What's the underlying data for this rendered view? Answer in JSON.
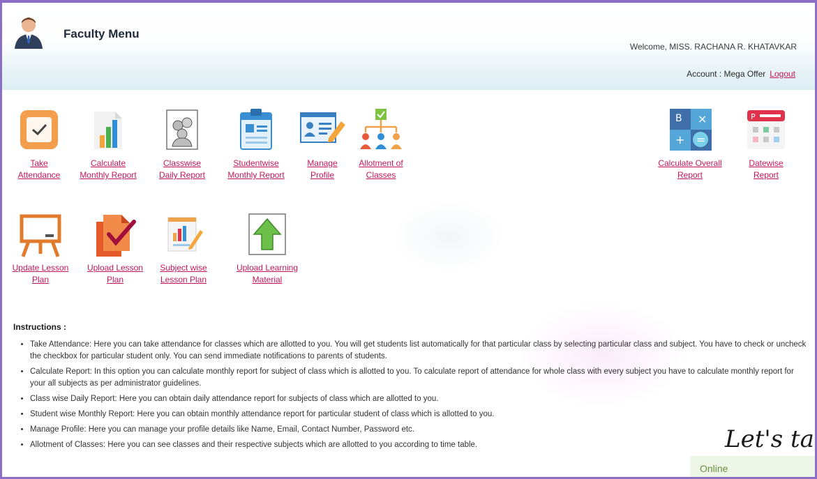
{
  "header": {
    "title": "Faculty Menu",
    "welcome": "Welcome, MISS. RACHANA R. KHATAVKAR",
    "account_label": "Account : Mega Offer",
    "logout_label": "Logout"
  },
  "menu": {
    "take_attendance": {
      "line1": "Take",
      "line2": "Attendance"
    },
    "calculate_monthly": {
      "line1": "Calculate",
      "line2": "Monthly Report"
    },
    "classwise_daily": {
      "line1": "Classwise",
      "line2": "Daily Report"
    },
    "studentwise_monthly": {
      "line1": "Studentwise",
      "line2": "Monthly Report"
    },
    "manage_profile": {
      "line1": "Manage",
      "line2": "Profile"
    },
    "allotment": {
      "line1": "Allotment of",
      "line2": "Classes"
    },
    "calculate_overall": {
      "line1": "Calculate Overall",
      "line2": "Report"
    },
    "datewise": {
      "line1": "Datewise",
      "line2": "Report"
    },
    "update_lesson": {
      "line1": "Update Lesson",
      "line2": "Plan"
    },
    "upload_lesson": {
      "line1": "Upload Lesson",
      "line2": "Plan"
    },
    "subject_lesson": {
      "line1": "Subject wise",
      "line2": "Lesson Plan"
    },
    "upload_material": {
      "line1": "Upload Learning",
      "line2": "Material"
    }
  },
  "instructions": {
    "title": "Instructions :",
    "items": [
      "Take Attendance: Here you can take attendance for classes which are allotted to you. You will get students list automatically for that particular class by selecting particular class and subject. You have to check or uncheck the checkbox for particular student only. You can send immediate notifications to parents of students.",
      "Calculate Report: In this option you can calculate monthly report for subject of class which is allotted to you. To calculate report of attendance for whole class with every subject you have to calculate monthly report for your all subjects as per administrator guidelines.",
      "Class wise Daily Report: Here you can obtain daily attendance report for subjects of class which are allotted to you.",
      "Student wise Monthly Report: Here you can obtain monthly attendance report for particular student of class which is allotted to you.",
      "Manage Profile: Here you can manage your profile details like Name, Email, Contact Number, Password etc.",
      "Allotment of Classes: Here you can see classes and their respective subjects which are allotted to you according to time table."
    ]
  },
  "chat": {
    "greeting": "Let's ta",
    "status": "Online"
  },
  "colors": {
    "link": "#c2185b",
    "border": "#8a6fc4",
    "header_band": "#dceef3"
  }
}
